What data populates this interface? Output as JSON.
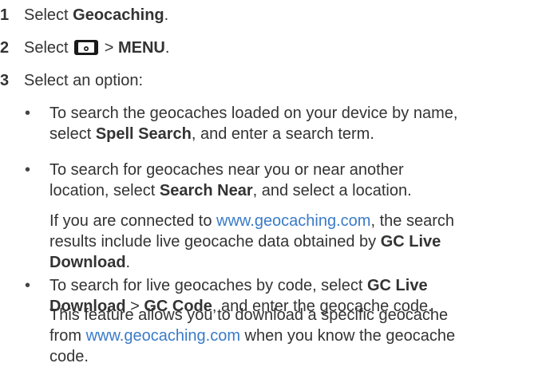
{
  "steps": [
    {
      "num": "1",
      "pre": "Select ",
      "bold": "Geocaching",
      "post": "."
    },
    {
      "num": "2",
      "pre": "Select ",
      "icon": "geocache-menu-icon",
      "mid": " > ",
      "bold": "MENU",
      "post": "."
    },
    {
      "num": "3",
      "text": "Select an option:"
    }
  ],
  "bullets": [
    {
      "dot": "•",
      "l1": "To search the geocaches loaded on your device by name,",
      "l2_pre": "select ",
      "l2_bold": "Spell Search",
      "l2_post": ", and enter a search term."
    },
    {
      "dot": "•",
      "l1": "To search for geocaches near you or near another",
      "l2_pre": "location, select ",
      "l2_bold": "Search Near",
      "l2_post": ", and select a location."
    },
    {
      "dot": "•",
      "l1_pre": "To search for live geocaches by code, select ",
      "l1_bold": "GC Live",
      "l2_bold": "Download",
      "l2_mid": " > ",
      "l2_bold2": "GC Code",
      "l2_post": ", and enter the geocache code."
    }
  ],
  "notes": [
    {
      "l1_pre": "If you are connected to ",
      "l1_link": "www.geocaching.com",
      "l1_post": ", the search",
      "l2_pre": "results include live geocache data obtained by ",
      "l2_bold": "GC Live",
      "l3_bold": "Download",
      "l3_post": "."
    },
    {
      "l1": "This feature allows you to download a specific geocache",
      "l2_pre": "from ",
      "l2_link": "www.geocaching.com",
      "l2_post": " when you know the geocache",
      "l3": "code."
    }
  ]
}
